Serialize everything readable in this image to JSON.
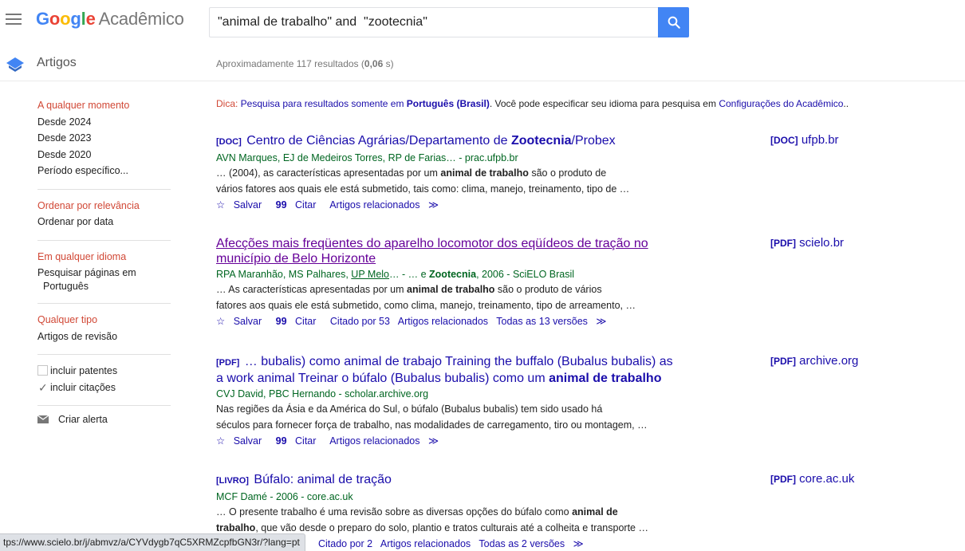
{
  "header": {
    "logo_google": "Google",
    "logo_product": "Acadêmico",
    "search_value": "\"animal de trabalho\" and  \"zootecnia\""
  },
  "subbar": {
    "section": "Artigos",
    "results_prefix": "Aproximadamente 117 resultados (",
    "results_time": "0,06",
    "results_suffix": " s)"
  },
  "sidebar": {
    "time_filters": [
      "A qualquer momento",
      "Desde 2024",
      "Desde 2023",
      "Desde 2020",
      "Período específico..."
    ],
    "sort": [
      "Ordenar por relevância",
      "Ordenar por data"
    ],
    "language": [
      "Em qualquer idioma",
      "Pesquisar páginas em",
      "Português"
    ],
    "type": [
      "Qualquer tipo",
      "Artigos de revisão"
    ],
    "include_patents": "incluir patentes",
    "include_citations": "incluir citações",
    "create_alert": "Criar alerta"
  },
  "tip": {
    "label": "Dica:",
    "text1": " Pesquisa para resultados somente em ",
    "lang": "Português (Brasil)",
    "text2": ". Você pode especificar seu idioma para pesquisa em ",
    "link": "Configurações do Acadêmico",
    "text3": ".."
  },
  "results": [
    {
      "type": "[DOC]",
      "title_a": "Centro de Ciências Agrárias/Departamento de ",
      "title_b": "Zootecnia",
      "title_c": "/Probex",
      "authors": "AVN Marques, EJ de Medeiros Torres, RP de Farias… - prac.ufpb.br",
      "snip1a": "… (2004), as características apresentadas por um ",
      "snip1b": "animal de trabalho",
      "snip1c": " são o produto de",
      "snip2": "vários fatores aos quais ele está submetido, tais como: clima, manejo, treinamento, tipo de …",
      "save": "Salvar",
      "cite": "Citar",
      "related": "Artigos relacionados",
      "side_type": "[DOC]",
      "side_domain": "ufpb.br"
    },
    {
      "title_line1": "Afecções mais freqüentes do aparelho locomotor dos eqüídeos de tração no",
      "title_line2": "município de Belo Horizonte",
      "authors_a": "RPA Maranhão, MS Palhares, ",
      "authors_link": "UP Melo",
      "authors_b": "… - … e ",
      "authors_bold": "Zootecnia",
      "authors_c": ", 2006 - SciELO Brasil",
      "snip1a": "… As características apresentadas por um ",
      "snip1b": "animal de trabalho",
      "snip1c": " são o produto de vários",
      "snip2": "fatores aos quais ele está submetido, como clima, manejo, treinamento, tipo de arreamento, …",
      "save": "Salvar",
      "cite": "Citar",
      "cited_by": "Citado por 53",
      "related": "Artigos relacionados",
      "versions": "Todas as 13 versões",
      "side_type": "[PDF]",
      "side_domain": "scielo.br"
    },
    {
      "type": "[PDF]",
      "title_line1": "… bubalis) como animal de trabajo Training the buffalo (Bubalus bubalis) as",
      "title_line2a": "a work animal Treinar o búfalo (Bubalus bubalis) como um ",
      "title_line2b": "animal de trabalho",
      "authors": "CVJ David, PBC Hernando - scholar.archive.org",
      "snip1": "Nas regiões da Ásia e da América do Sul, o búfalo (Bubalus bubalis) tem sido usado há",
      "snip2": "séculos para fornecer força de trabalho, nas modalidades de carregamento, tiro ou montagem, …",
      "save": "Salvar",
      "cite": "Citar",
      "related": "Artigos relacionados",
      "side_type": "[PDF]",
      "side_domain": "archive.org"
    },
    {
      "type": "[LIVRO]",
      "title": "Búfalo: animal de tração",
      "authors": "MCF Damé - 2006 - core.ac.uk",
      "snip1a": "… O presente trabalho é uma revisão sobre as diversas opções do búfalo como ",
      "snip1b": "animal de",
      "snip2a": "trabalho",
      "snip2b": ", que vão desde o preparo do solo, plantio e tratos culturais até a colheita e transporte …",
      "cited_by": "Citado por 2",
      "related": "Artigos relacionados",
      "versions": "Todas as 2 versões",
      "side_type": "[PDF]",
      "side_domain": "core.ac.uk"
    }
  ],
  "statusbar": "tps://www.scielo.br/j/abmvz/a/CYVdygb7qC5XRMZcpfbGN3r/?lang=pt"
}
